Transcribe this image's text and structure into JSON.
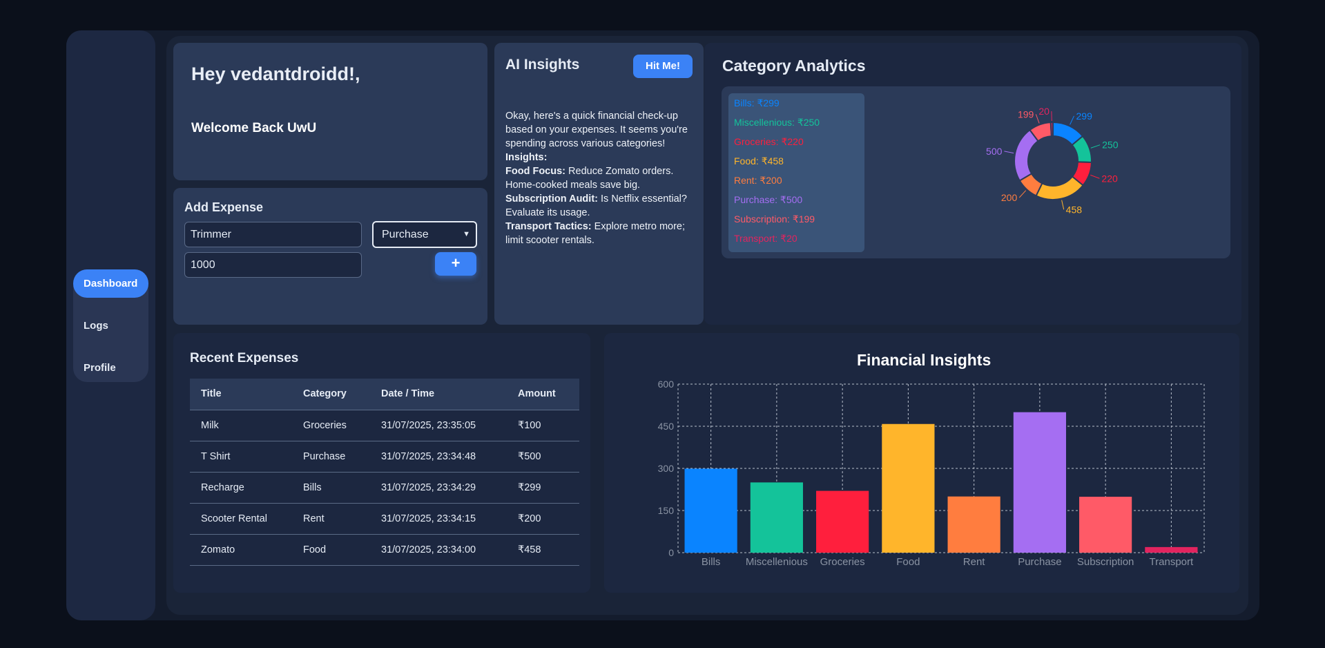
{
  "sidebar": {
    "items": [
      {
        "label": "Dashboard",
        "active": true
      },
      {
        "label": "Logs"
      },
      {
        "label": "Profile"
      }
    ]
  },
  "greeting": {
    "title": "Hey vedantdroidd!,",
    "subtitle": "Welcome Back UwU"
  },
  "add_expense": {
    "title": "Add Expense",
    "title_value": "Trimmer",
    "category_value": "Purchase",
    "amount_value": "1000",
    "add_label": "+"
  },
  "ai": {
    "title": "AI Insights",
    "button": "Hit Me!",
    "intro": "Okay, here's a quick financial check-up based on your expenses. It seems you're spending across various categories!",
    "insights_label": "Insights:",
    "items": [
      {
        "k": "Food Focus:",
        "v": " Reduce Zomato orders. Home-cooked meals save big."
      },
      {
        "k": "Subscription Audit:",
        "v": " Is Netflix essential? Evaluate its usage."
      },
      {
        "k": "Transport Tactics:",
        "v": " Explore metro more; limit scooter rentals."
      }
    ]
  },
  "category_analytics": {
    "title": "Category Analytics",
    "legend": [
      "Bills: ₹299",
      "Miscellenious: ₹250",
      "Groceries: ₹220",
      "Food: ₹458",
      "Rent: ₹200",
      "Purchase: ₹500",
      "Subscription: ₹199",
      "Transport: ₹20"
    ]
  },
  "colors": {
    "Bills": "#0a84ff",
    "Miscellenious": "#14c39a",
    "Groceries": "#ff1f3d",
    "Food": "#ffb52b",
    "Rent": "#ff7d3f",
    "Purchase": "#a56ef2",
    "Subscription": "#ff5a67",
    "Transport": "#e2245f"
  },
  "recent": {
    "title": "Recent Expenses",
    "headers": [
      "Title",
      "Category",
      "Date / Time",
      "Amount"
    ],
    "rows": [
      [
        "Milk",
        "Groceries",
        "31/07/2025, 23:35:05",
        "₹100"
      ],
      [
        "T Shirt",
        "Purchase",
        "31/07/2025, 23:34:48",
        "₹500"
      ],
      [
        "Recharge",
        "Bills",
        "31/07/2025, 23:34:29",
        "₹299"
      ],
      [
        "Scooter Rental",
        "Rent",
        "31/07/2025, 23:34:15",
        "₹200"
      ],
      [
        "Zomato",
        "Food",
        "31/07/2025, 23:34:00",
        "₹458"
      ]
    ]
  },
  "chart_data": [
    {
      "type": "pie",
      "donut": true,
      "title": "",
      "labels": [
        "Bills",
        "Miscellenious",
        "Groceries",
        "Food",
        "Rent",
        "Purchase",
        "Subscription",
        "Transport"
      ],
      "values": [
        299,
        250,
        220,
        458,
        200,
        500,
        199,
        20
      ]
    },
    {
      "type": "bar",
      "title": "Financial Insights",
      "xlabel": "",
      "ylabel": "",
      "categories": [
        "Bills",
        "Miscellenious",
        "Groceries",
        "Food",
        "Rent",
        "Purchase",
        "Subscription",
        "Transport"
      ],
      "values": [
        299,
        250,
        220,
        458,
        200,
        500,
        199,
        20
      ],
      "ylim": [
        0,
        600
      ],
      "yticks": [
        0,
        150,
        300,
        450,
        600
      ],
      "grid": true
    }
  ]
}
